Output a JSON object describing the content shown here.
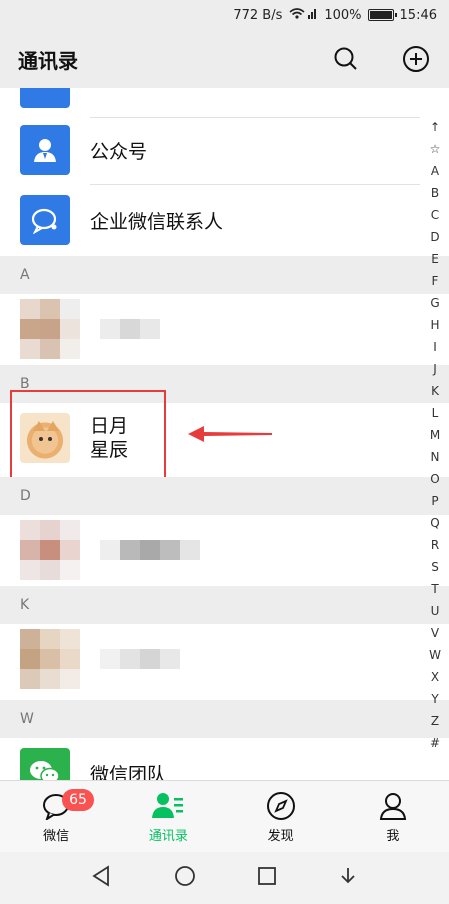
{
  "status_bar": {
    "speed": "772 B/s",
    "network": "4G",
    "battery": "100%",
    "time": "15:46"
  },
  "header": {
    "title": "通讯录",
    "search_icon": "search-icon",
    "add_icon": "add-circle-icon"
  },
  "rows": {
    "official_accounts": "公众号",
    "enterprise_contacts": "企业微信联系人",
    "contact_b": [
      "日月",
      "星辰"
    ],
    "wechat_team": "微信团队"
  },
  "sections": {
    "a": "A",
    "b": "B",
    "d": "D",
    "k": "K",
    "w": "W"
  },
  "index_letters": [
    "↑",
    "☆",
    "A",
    "B",
    "C",
    "D",
    "E",
    "F",
    "G",
    "H",
    "I",
    "J",
    "K",
    "L",
    "M",
    "N",
    "O",
    "P",
    "Q",
    "R",
    "S",
    "T",
    "U",
    "V",
    "W",
    "X",
    "Y",
    "Z",
    "#"
  ],
  "tabs": [
    {
      "label": "微信",
      "badge": "65"
    },
    {
      "label": "通讯录"
    },
    {
      "label": "发现"
    },
    {
      "label": "我"
    }
  ],
  "colors": {
    "accent": "#07c160",
    "badge": "#fa5151",
    "highlight": "#e63c3c"
  }
}
